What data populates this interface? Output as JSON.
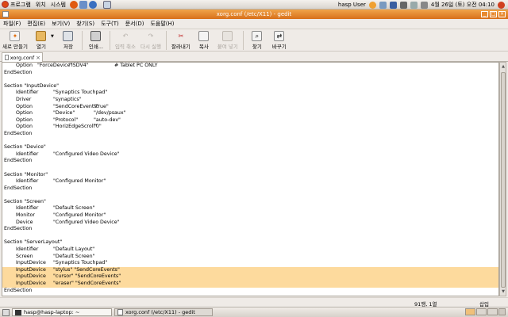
{
  "top_panel": {
    "menus": [
      "프로그램",
      "위치",
      "시스템"
    ],
    "user": "hasp User",
    "datetime": "4월 26일 (토) 오전 04:10"
  },
  "window": {
    "title": "xorg.conf (/etc/X11) - gedit"
  },
  "menubar": [
    "파일(F)",
    "편집(E)",
    "보기(V)",
    "찾기(S)",
    "도구(T)",
    "문서(D)",
    "도움말(H)"
  ],
  "toolbar": {
    "new": "새로 만들기",
    "open": "열기",
    "save": "저장",
    "print": "인쇄...",
    "undo": "입력 취소",
    "redo": "다시 실행",
    "cut": "잘라내기",
    "copy": "복사",
    "paste": "붙여 넣기",
    "find": "찾기",
    "replace": "바꾸기"
  },
  "tab": {
    "label": "xorg.conf"
  },
  "lines": [
    {
      "cols": [
        "Option",
        "\"ForceDevice\"",
        "\"ISDV4\"",
        "# Tablet PC ONLY"
      ],
      "hl": false
    },
    {
      "cols": [
        "EndSection"
      ],
      "hl": false
    },
    {
      "cols": [
        ""
      ],
      "hl": false
    },
    {
      "cols": [
        "Section \"InputDevice\""
      ],
      "hl": false
    },
    {
      "cols": [
        "Identifier",
        "\"Synaptics Touchpad\""
      ],
      "hl": false
    },
    {
      "cols": [
        "Driver",
        "\"synaptics\""
      ],
      "hl": false
    },
    {
      "cols": [
        "Option",
        "\"SendCoreEvents\"",
        "\"true\""
      ],
      "hl": false
    },
    {
      "cols": [
        "Option",
        "\"Device\"",
        "\"/dev/psaux\""
      ],
      "hl": false
    },
    {
      "cols": [
        "Option",
        "\"Protocol\"",
        "\"auto-dev\""
      ],
      "hl": false
    },
    {
      "cols": [
        "Option",
        "\"HorizEdgeScroll\"",
        "\"0\""
      ],
      "hl": false
    },
    {
      "cols": [
        "EndSection"
      ],
      "hl": false
    },
    {
      "cols": [
        ""
      ],
      "hl": false
    },
    {
      "cols": [
        "Section \"Device\""
      ],
      "hl": false
    },
    {
      "cols": [
        "Identifier",
        "\"Configured Video Device\""
      ],
      "hl": false
    },
    {
      "cols": [
        "EndSection"
      ],
      "hl": false
    },
    {
      "cols": [
        ""
      ],
      "hl": false
    },
    {
      "cols": [
        "Section \"Monitor\""
      ],
      "hl": false
    },
    {
      "cols": [
        "Identifier",
        "\"Configured Monitor\""
      ],
      "hl": false
    },
    {
      "cols": [
        "EndSection"
      ],
      "hl": false
    },
    {
      "cols": [
        ""
      ],
      "hl": false
    },
    {
      "cols": [
        "Section \"Screen\""
      ],
      "hl": false
    },
    {
      "cols": [
        "Identifier",
        "\"Default Screen\""
      ],
      "hl": false
    },
    {
      "cols": [
        "Monitor",
        "\"Configured Monitor\""
      ],
      "hl": false
    },
    {
      "cols": [
        "Device",
        "\"Configured Video Device\""
      ],
      "hl": false
    },
    {
      "cols": [
        "EndSection"
      ],
      "hl": false
    },
    {
      "cols": [
        ""
      ],
      "hl": false
    },
    {
      "cols": [
        "Section \"ServerLayout\""
      ],
      "hl": false
    },
    {
      "cols": [
        "Identifier",
        "\"Default Layout\""
      ],
      "hl": false
    },
    {
      "cols": [
        "Screen",
        "\"Default Screen\""
      ],
      "hl": false
    },
    {
      "cols": [
        "InputDevice",
        "\"Synaptics Touchpad\""
      ],
      "hl": false
    },
    {
      "cols": [
        "InputDevice",
        "\"stylus\" \"SendCoreEvents\""
      ],
      "hl": true
    },
    {
      "cols": [
        "InputDevice",
        "\"cursor\" \"SendCoreEvents\""
      ],
      "hl": true
    },
    {
      "cols": [
        "InputDevice",
        "\"eraser\" \"SendCoreEvents\""
      ],
      "hl": true
    },
    {
      "cols": [
        "EndSection"
      ],
      "hl": false
    }
  ],
  "status": {
    "position": "91행, 1열",
    "mode": "삽입"
  },
  "taskbar": {
    "items": [
      "hasp@hasp-laptop: ~",
      "xorg.conf (/etc/X11) - gedit"
    ]
  },
  "colors": {
    "highlight": "#fdda9d",
    "titlebar": "#e08a2e"
  }
}
